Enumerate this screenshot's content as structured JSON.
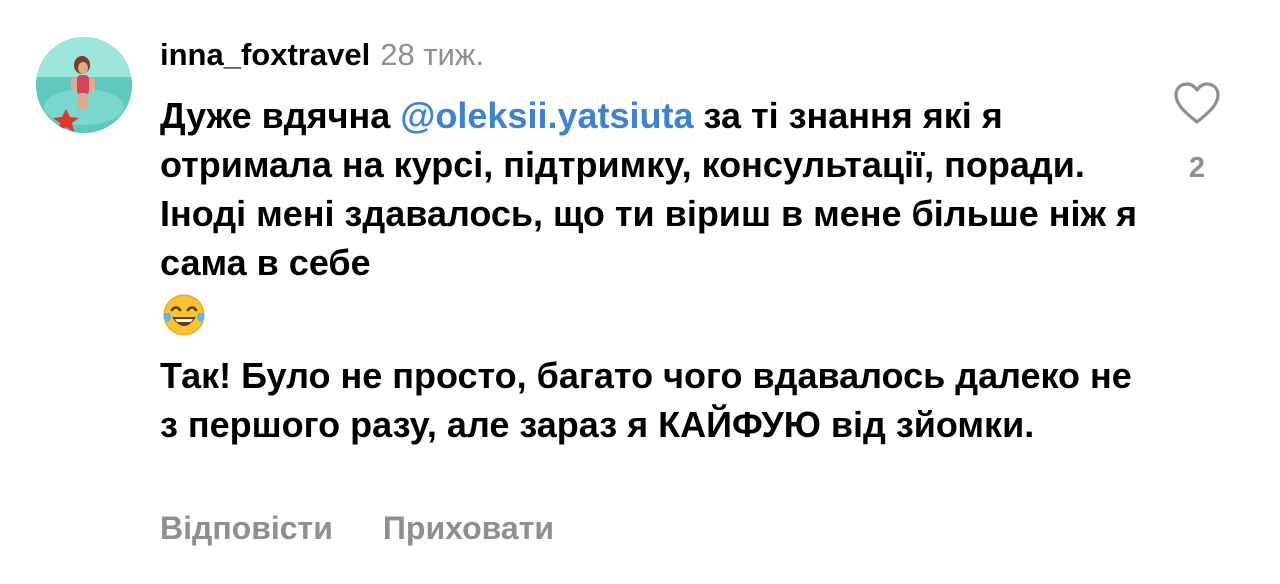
{
  "comment": {
    "username": "inna_foxtravel",
    "timestamp": "28 тиж.",
    "paragraph1": {
      "before_mention": "Дуже вдячна ",
      "mention": "@oleksii.yatsiuta",
      "after_mention": " за ті знання які я отримала на курсі, підтримку, консультації, поради. Іноді мені здавалось, що ти віриш в мене більше ніж я сама в себе"
    },
    "paragraph2": "Так! Було не просто, багато чого вдавалось далеко не з першого разу, але зараз я КАЙФУЮ від зйомки.",
    "emoji": "face-with-tears-of-joy",
    "likes_count": "2"
  },
  "actions": {
    "reply_label": "Відповісти",
    "hide_label": "Приховати"
  },
  "colors": {
    "mention": "#3d82d6",
    "muted": "#8e8e93",
    "text": "#000000"
  },
  "icons": {
    "like": "heart-outline-icon"
  }
}
